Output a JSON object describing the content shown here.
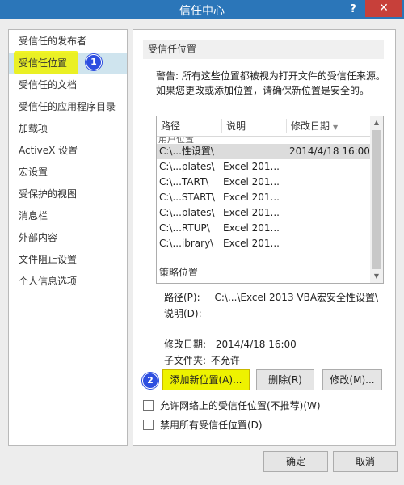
{
  "window": {
    "title": "信任中心",
    "help": "?",
    "close": "✕"
  },
  "sidebar": {
    "items": [
      {
        "label": "受信任的发布者"
      },
      {
        "label": "受信任位置"
      },
      {
        "label": "受信任的文档"
      },
      {
        "label": "受信任的应用程序目录"
      },
      {
        "label": "加载项"
      },
      {
        "label": "ActiveX 设置"
      },
      {
        "label": "宏设置"
      },
      {
        "label": "受保护的视图"
      },
      {
        "label": "消息栏"
      },
      {
        "label": "外部内容"
      },
      {
        "label": "文件阻止设置"
      },
      {
        "label": "个人信息选项"
      }
    ],
    "selected_index": 1
  },
  "main": {
    "section_title": "受信任位置",
    "warning": "警告: 所有这些位置都被视为打开文件的受信任来源。如果您更改或添加位置，请确保新位置是安全的。",
    "list": {
      "headers": {
        "path": "路径",
        "description": "说明",
        "modified": "修改日期"
      },
      "group_user_partial": "用户位置",
      "rows": [
        {
          "path": "C:\\...性设置\\",
          "description": "",
          "modified": "2014/4/18 16:00"
        },
        {
          "path": "C:\\...plates\\",
          "description": "Excel 201...",
          "modified": ""
        },
        {
          "path": "C:\\...TART\\",
          "description": "Excel 201...",
          "modified": ""
        },
        {
          "path": "C:\\...START\\",
          "description": "Excel 201...",
          "modified": ""
        },
        {
          "path": "C:\\...plates\\",
          "description": "Excel 201...",
          "modified": ""
        },
        {
          "path": "C:\\...RTUP\\",
          "description": "Excel 201...",
          "modified": ""
        },
        {
          "path": "C:\\...ibrary\\",
          "description": "Excel 201...",
          "modified": ""
        }
      ],
      "group_policy": "策略位置"
    },
    "details": {
      "path_label": "路径(P):",
      "path_value": "C:\\...\\Excel 2013 VBA宏安全性设置\\",
      "desc_label": "说明(D):",
      "desc_value": "",
      "date_label": "修改日期:",
      "date_value": "2014/4/18 16:00",
      "subfolder_label": "子文件夹:",
      "subfolder_value": "不允许"
    },
    "buttons": {
      "add": "添加新位置(A)...",
      "remove": "删除(R)",
      "modify": "修改(M)..."
    },
    "checkboxes": {
      "allow_network": "允许网络上的受信任位置(不推荐)(W)",
      "disable_all": "禁用所有受信任位置(D)"
    }
  },
  "callouts": {
    "one": "1",
    "two": "2"
  },
  "footer": {
    "ok": "确定",
    "cancel": "取消"
  },
  "colors": {
    "titlebar": "#2b76b9",
    "highlight": "#eef200",
    "callout": "#2d4ee0",
    "close": "#c7403a"
  }
}
